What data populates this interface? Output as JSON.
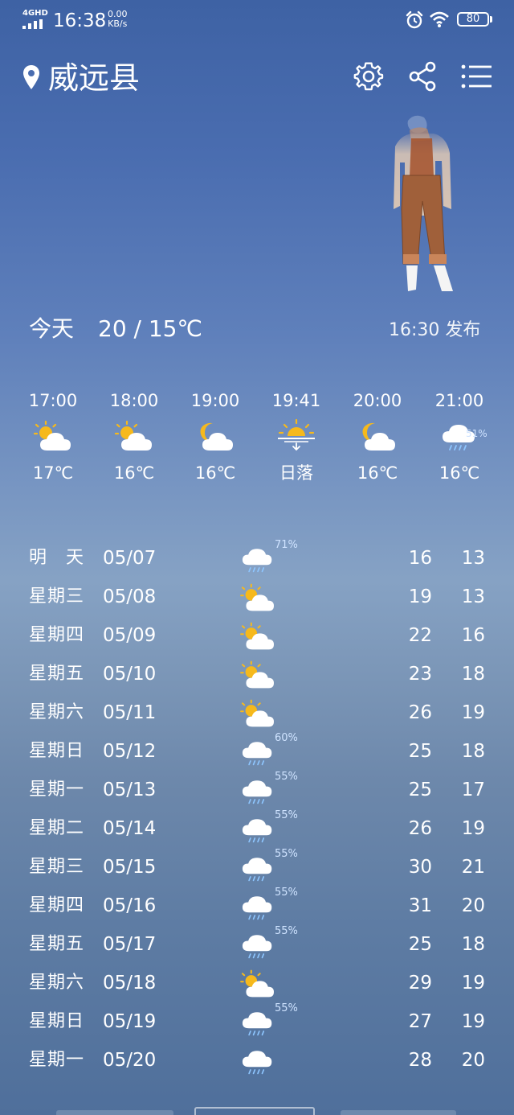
{
  "status_bar": {
    "network": "4GHD",
    "time": "16:38",
    "speed_value": "0.00",
    "speed_unit": "KB/s",
    "battery": "80",
    "icons": [
      "signal-icon",
      "alarm-icon",
      "wifi-icon",
      "battery-icon"
    ]
  },
  "header": {
    "city": "威远县",
    "icons": [
      "location-pin-icon",
      "settings-icon",
      "share-icon",
      "menu-icon"
    ]
  },
  "today": {
    "label": "今天",
    "temp_range": "20 / 15℃",
    "publish_time": "16:30 发布"
  },
  "hourly": [
    {
      "time": "17:00",
      "icon": "partly-cloudy-day",
      "temp": "17℃",
      "pop": ""
    },
    {
      "time": "18:00",
      "icon": "partly-cloudy-day",
      "temp": "16℃",
      "pop": ""
    },
    {
      "time": "19:00",
      "icon": "partly-cloudy-night",
      "temp": "16℃",
      "pop": ""
    },
    {
      "time": "19:41",
      "icon": "sunset",
      "temp": "日落",
      "pop": ""
    },
    {
      "time": "20:00",
      "icon": "partly-cloudy-night",
      "temp": "16℃",
      "pop": ""
    },
    {
      "time": "21:00",
      "icon": "rain",
      "temp": "16℃",
      "pop": "51%"
    }
  ],
  "daily": [
    {
      "day": "明　天",
      "date": "05/07",
      "icon": "rain",
      "pop": "71%",
      "high": "16",
      "low": "13"
    },
    {
      "day": "星期三",
      "date": "05/08",
      "icon": "partly-cloudy-day",
      "pop": "",
      "high": "19",
      "low": "13"
    },
    {
      "day": "星期四",
      "date": "05/09",
      "icon": "partly-cloudy-day",
      "pop": "",
      "high": "22",
      "low": "16"
    },
    {
      "day": "星期五",
      "date": "05/10",
      "icon": "partly-cloudy-day",
      "pop": "",
      "high": "23",
      "low": "18"
    },
    {
      "day": "星期六",
      "date": "05/11",
      "icon": "partly-cloudy-day",
      "pop": "",
      "high": "26",
      "low": "19"
    },
    {
      "day": "星期日",
      "date": "05/12",
      "icon": "rain",
      "pop": "60%",
      "high": "25",
      "low": "18"
    },
    {
      "day": "星期一",
      "date": "05/13",
      "icon": "rain",
      "pop": "55%",
      "high": "25",
      "low": "17"
    },
    {
      "day": "星期二",
      "date": "05/14",
      "icon": "rain",
      "pop": "55%",
      "high": "26",
      "low": "19"
    },
    {
      "day": "星期三",
      "date": "05/15",
      "icon": "rain",
      "pop": "55%",
      "high": "30",
      "low": "21"
    },
    {
      "day": "星期四",
      "date": "05/16",
      "icon": "rain",
      "pop": "55%",
      "high": "31",
      "low": "20"
    },
    {
      "day": "星期五",
      "date": "05/17",
      "icon": "rain",
      "pop": "55%",
      "high": "25",
      "low": "18"
    },
    {
      "day": "星期六",
      "date": "05/18",
      "icon": "partly-cloudy-day",
      "pop": "",
      "high": "29",
      "low": "19"
    },
    {
      "day": "星期日",
      "date": "05/19",
      "icon": "rain",
      "pop": "55%",
      "high": "27",
      "low": "19"
    },
    {
      "day": "星期一",
      "date": "05/20",
      "icon": "rain",
      "pop": "",
      "high": "28",
      "low": "20"
    }
  ],
  "colors": {
    "sun": "#f6b91c",
    "cloud": "#ffffff",
    "rain": "#8ec6ff",
    "pop_text": "#cfe3ff"
  }
}
